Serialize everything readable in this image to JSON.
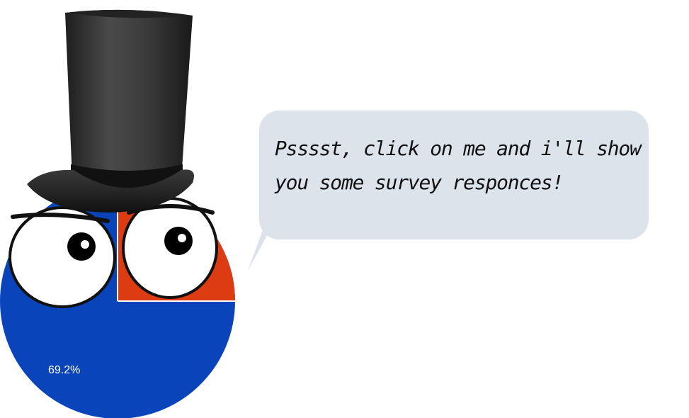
{
  "character": {
    "hat_icon": "top-hat-icon",
    "colors": {
      "pie_blue": "#0a44bb",
      "pie_red": "#dd3b12",
      "hat": "#2b2b2b",
      "eye_white": "#ffffff",
      "pupil": "#000000"
    }
  },
  "chart_data": {
    "type": "pie",
    "slices": [
      {
        "value": 69.2,
        "label": "69.2%",
        "color": "#0a44bb"
      },
      {
        "value": 30.8,
        "label": "",
        "color": "#dd3b12"
      }
    ]
  },
  "speech_bubble": {
    "lines": [
      "Psssst, click on me and i'll show",
      "you some survey responces!"
    ],
    "color": "#dde3ea"
  }
}
